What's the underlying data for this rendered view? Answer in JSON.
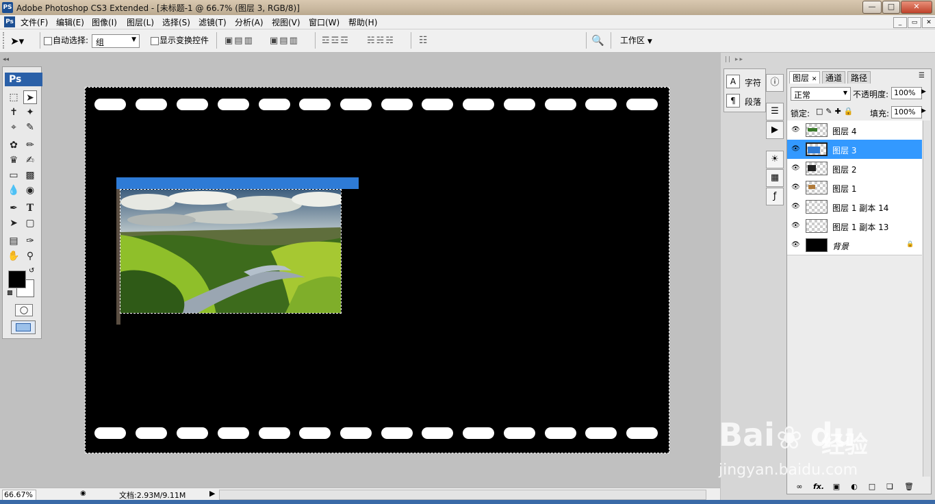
{
  "window": {
    "app_icon": "PS",
    "title": "Adobe Photoshop CS3 Extended - [未标题-1 @ 66.7% (图层 3, RGB/8)]",
    "controls": [
      "minimize-icon",
      "maximize-icon",
      "close-icon"
    ]
  },
  "menubar": {
    "items": [
      "文件(F)",
      "编辑(E)",
      "图像(I)",
      "图层(L)",
      "选择(S)",
      "滤镜(T)",
      "分析(A)",
      "视图(V)",
      "窗口(W)",
      "帮助(H)"
    ]
  },
  "options": {
    "auto_select_label": "自动选择:",
    "auto_select_value": "组",
    "show_transform_label": "显示变换控件",
    "workspace_label": "工作区"
  },
  "toolbox": {
    "logo": "Ps",
    "tools": [
      "marquee-icon",
      "move-icon",
      "lasso-icon",
      "magic-wand-icon",
      "crop-icon",
      "slice-icon",
      "healing-icon",
      "brush-icon",
      "stamp-icon",
      "history-brush-icon",
      "eraser-icon",
      "gradient-icon",
      "blur-icon",
      "dodge-icon",
      "pen-icon",
      "type-icon",
      "path-select-icon",
      "shape-icon",
      "notes-icon",
      "eyedropper-icon",
      "hand-icon",
      "zoom-icon"
    ],
    "foreground_color": "#000000",
    "background_color": "#ffffff"
  },
  "statusbar": {
    "zoom": "66.67%",
    "doc_info": "文档:2.93M/9.11M"
  },
  "character_panel": {
    "char_label": "字符",
    "para_label": "段落"
  },
  "layers_panel": {
    "tabs": [
      "图层",
      "通道",
      "路径"
    ],
    "blend_mode": "正常",
    "opacity_label": "不透明度:",
    "opacity_value": "100%",
    "lock_label": "锁定:",
    "fill_label": "填充:",
    "fill_value": "100%",
    "layers": [
      {
        "name": "图层 4",
        "visible": true,
        "active": false
      },
      {
        "name": "图层 3",
        "visible": true,
        "active": true
      },
      {
        "name": "图层 2",
        "visible": true,
        "active": false
      },
      {
        "name": "图层 1",
        "visible": true,
        "active": false
      },
      {
        "name": "图层 1 副本 14",
        "visible": true,
        "active": false
      },
      {
        "name": "图层 1 副本 13",
        "visible": true,
        "active": false
      },
      {
        "name": "背景",
        "visible": true,
        "active": false,
        "locked": true
      }
    ]
  },
  "watermark": {
    "brand": "Bai",
    "brand2": "du",
    "brand_cn": "经验",
    "url": "jingyan.baidu.com"
  },
  "colors": {
    "selection_blue": "#3399ff",
    "canvas_bg": "#000000",
    "layer_bar_blue": "#2e7bd6"
  }
}
